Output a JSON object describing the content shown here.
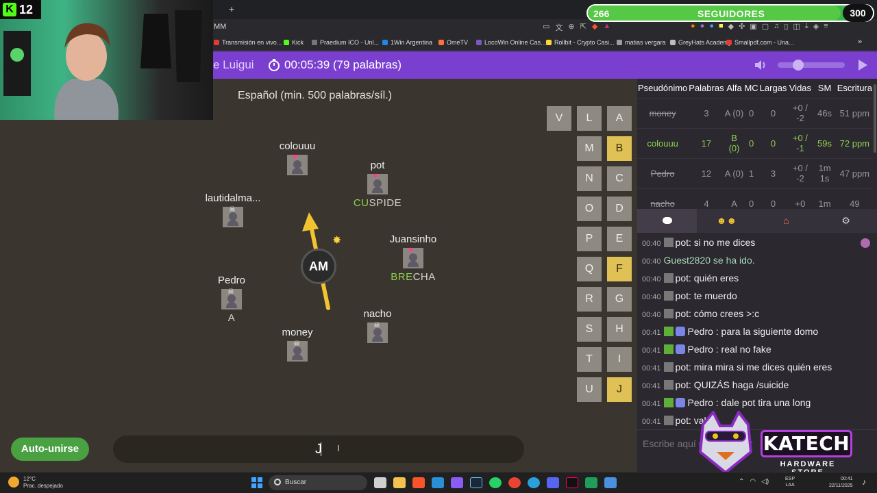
{
  "followers": {
    "current": "266",
    "label": "SEGUIDORES",
    "goal": "300",
    "progress": 0.887
  },
  "stream": {
    "viewer_count": "12"
  },
  "browser": {
    "newtab_icon": "+",
    "url_text": "MM",
    "bookmarks": [
      {
        "label": "Transmisión en vivo...",
        "color": "#e53935"
      },
      {
        "label": "Kick",
        "color": "#53fc18"
      },
      {
        "label": "Praedium ICO - Unl...",
        "color": "#777777"
      },
      {
        "label": "1Win Argentina",
        "color": "#1e88e5"
      },
      {
        "label": "OmeTV",
        "color": "#ff7043"
      },
      {
        "label": "LocoWin Online Cas...",
        "color": "#7e57c2"
      },
      {
        "label": "Rollbit - Crypto Casi...",
        "color": "#fdd835"
      },
      {
        "label": "matias vergara",
        "color": "#9e9e9e"
      },
      {
        "label": "GreyHats Academy",
        "color": "#bdbdbd"
      },
      {
        "label": "Smallpdf.com - Una...",
        "color": "#e53935"
      }
    ],
    "more": "»"
  },
  "game": {
    "room_name": "e Luigui",
    "timer": "00:05:39 (79 palabras)",
    "language": "Español (min. 500 palabras/síl.)",
    "prompt": "AM",
    "players": [
      {
        "name": "colouuu",
        "marker": "♥",
        "word_hl": "",
        "word_rest": ""
      },
      {
        "name": "pot",
        "marker": "♥",
        "word_hl": "CU",
        "word_rest": "SPIDE"
      },
      {
        "name": "lautidalma...",
        "marker": "☠",
        "word_hl": "",
        "word_rest": ""
      },
      {
        "name": "Juansinho",
        "marker": "♥",
        "word_hl": "BRE",
        "word_rest": "CHA"
      },
      {
        "name": "Pedro",
        "marker": "☠",
        "word_hl": "",
        "word_rest": "A"
      },
      {
        "name": "nacho",
        "marker": "☠",
        "word_hl": "",
        "word_rest": ""
      },
      {
        "name": "money",
        "marker": "☠",
        "word_hl": "",
        "word_rest": ""
      }
    ],
    "letters": [
      {
        "l": "V",
        "on": false
      },
      {
        "l": "L",
        "on": false
      },
      {
        "l": "A",
        "on": false
      },
      {
        "l": "M",
        "on": false
      },
      {
        "l": "B",
        "on": true
      },
      {
        "l": "N",
        "on": false
      },
      {
        "l": "C",
        "on": false
      },
      {
        "l": "O",
        "on": false
      },
      {
        "l": "D",
        "on": false
      },
      {
        "l": "P",
        "on": false
      },
      {
        "l": "E",
        "on": false
      },
      {
        "l": "Q",
        "on": false
      },
      {
        "l": "F",
        "on": true
      },
      {
        "l": "R",
        "on": false
      },
      {
        "l": "G",
        "on": false
      },
      {
        "l": "S",
        "on": false
      },
      {
        "l": "H",
        "on": false
      },
      {
        "l": "T",
        "on": false
      },
      {
        "l": "I",
        "on": false
      },
      {
        "l": "U",
        "on": false
      },
      {
        "l": "J",
        "on": true
      }
    ],
    "auto_join": "Auto-unirse",
    "typed": "J"
  },
  "scoreboard": {
    "headers": [
      "Pseudónimo",
      "Palabras",
      "Alfa",
      "MC",
      "Largas",
      "Vidas",
      "SM",
      "Escritura"
    ],
    "rows": [
      {
        "status": "dead",
        "cells": [
          "money",
          "3",
          "A (0)",
          "0",
          "0",
          "+0 / -2",
          "46s",
          "51 ppm"
        ]
      },
      {
        "status": "alive",
        "cells": [
          "colouuu",
          "17",
          "B (0)",
          "0",
          "0",
          "+0 / -1",
          "59s",
          "72 ppm"
        ]
      },
      {
        "status": "dead",
        "cells": [
          "Pedro",
          "12",
          "A (0)",
          "1",
          "3",
          "+0 / -2",
          "1m 1s",
          "47 ppm"
        ]
      },
      {
        "status": "dead",
        "cells": [
          "nacho",
          "4",
          "A",
          "0",
          "0",
          "+0",
          "1m",
          "49"
        ]
      }
    ]
  },
  "chat": {
    "tabs": [
      "chat-icon",
      "players-icon",
      "room-icon",
      "settings-icon"
    ],
    "placeholder": "Escribe aquí para chatear",
    "messages": [
      {
        "time": "00:40",
        "type": "user",
        "text": "pot: si no me dices"
      },
      {
        "time": "00:40",
        "type": "system",
        "text": "Guest2820 se ha ido."
      },
      {
        "time": "00:40",
        "type": "user",
        "text": "pot: quién eres"
      },
      {
        "time": "00:40",
        "type": "user",
        "text": "pot: te muerdo"
      },
      {
        "time": "00:40",
        "type": "user",
        "text": "pot: cómo crees >:c"
      },
      {
        "time": "00:41",
        "type": "discord",
        "text": "Pedro : para la siguiente domo"
      },
      {
        "time": "00:41",
        "type": "discord",
        "text": "Pedro : real no fake"
      },
      {
        "time": "00:41",
        "type": "user",
        "text": "pot: mira mira si me dices quién eres"
      },
      {
        "time": "00:41",
        "type": "user",
        "text": "pot: QUIZÁS haga /suicide"
      },
      {
        "time": "00:41",
        "type": "discord",
        "text": "Pedro : dale pot tira una long"
      },
      {
        "time": "00:41",
        "type": "user",
        "text": "pot: val"
      }
    ]
  },
  "sponsor": {
    "brand": "KATECH",
    "tagline": "HARDWARE STORE"
  },
  "taskbar": {
    "temp": "12°C",
    "weather": "Prac. despejado",
    "search": "Buscar",
    "lang1": "ESP",
    "lang2": "LAA",
    "time": "00:41",
    "date": "22/11/2025"
  }
}
